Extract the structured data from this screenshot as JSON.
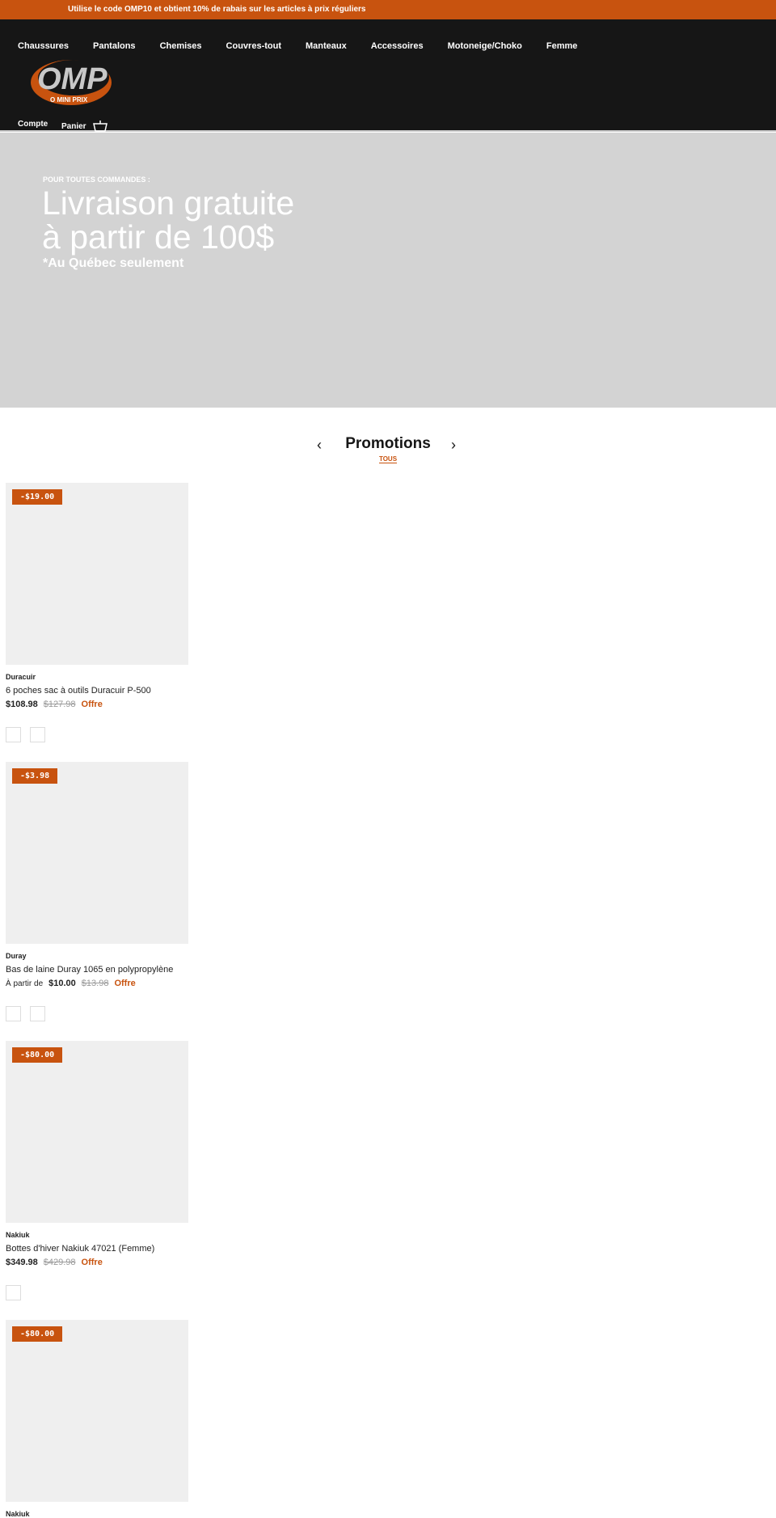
{
  "promo_bar": {
    "text": "Utilise le code OMP10 et obtient 10% de rabais sur les articles à prix réguliers"
  },
  "nav": [
    "Chaussures",
    "Pantalons",
    "Chemises",
    "Couvres-tout",
    "Manteaux",
    "Accessoires",
    "Motoneige/Choko",
    "Femme"
  ],
  "logo": {
    "text": "OMP",
    "tagline": "O MINI PRIX"
  },
  "header": {
    "account": "Compte",
    "cart": "Panier"
  },
  "hero": {
    "pre": "POUR TOUTES COMMANDES :",
    "line1": "Livraison gratuite",
    "line2": "à partir de 100$",
    "sub": "*Au Québec seulement"
  },
  "section": {
    "title": "Promotions",
    "link": "TOUS"
  },
  "colors": {
    "accent": "#c8530f",
    "header": "#161616",
    "hero": "#d3d3d3"
  },
  "products": [
    {
      "badge": "-$19.00",
      "brand": "Duracuir",
      "title": "6 poches sac à outils Duracuir P-500",
      "from": "",
      "price": "$108.98",
      "old": "$127.98",
      "offer": "Offre",
      "swatches": 2
    },
    {
      "badge": "-$3.98",
      "brand": "Duray",
      "title": "Bas de laine Duray 1065 en polypropylène",
      "from": "À partir de",
      "price": "$10.00",
      "old": "$13.98",
      "offer": "Offre",
      "swatches": 2
    },
    {
      "badge": "-$80.00",
      "brand": "Nakiuk",
      "title": "Bottes d'hiver Nakiuk 47021 (Femme)",
      "from": "",
      "price": "$349.98",
      "old": "$429.98",
      "offer": "Offre",
      "swatches": 1
    },
    {
      "badge": "-$80.00",
      "brand": "Nakiuk",
      "title": "",
      "from": "",
      "price": "",
      "old": "",
      "offer": "",
      "swatches": 0
    }
  ]
}
